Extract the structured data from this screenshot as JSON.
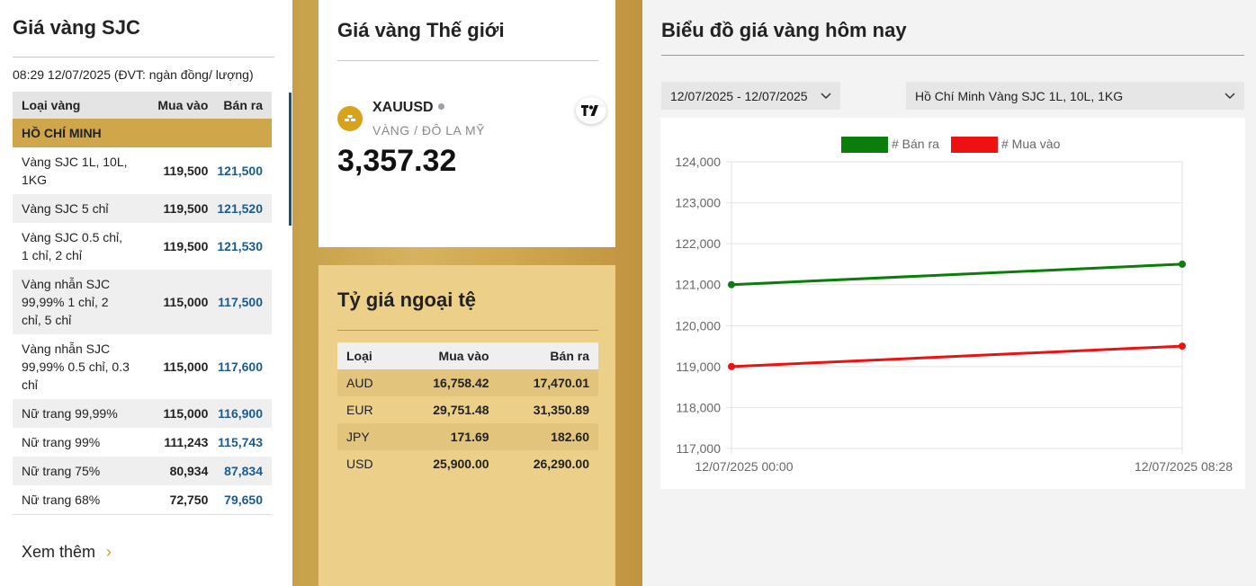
{
  "sjc": {
    "title": "Giá vàng SJC",
    "meta": "08:29 12/07/2025 (ĐVT: ngàn đồng/ lượng)",
    "headers": {
      "type": "Loại vàng",
      "buy": "Mua vào",
      "sell": "Bán ra"
    },
    "region": "HỒ CHÍ MINH",
    "rows": [
      {
        "name": "Vàng SJC 1L, 10L, 1KG",
        "buy": "119,500",
        "sell": "121,500"
      },
      {
        "name": "Vàng SJC 5 chỉ",
        "buy": "119,500",
        "sell": "121,520"
      },
      {
        "name": "Vàng SJC 0.5 chỉ, 1 chỉ, 2 chỉ",
        "buy": "119,500",
        "sell": "121,530"
      },
      {
        "name": "Vàng nhẫn SJC 99,99% 1 chỉ, 2 chỉ, 5 chỉ",
        "buy": "115,000",
        "sell": "117,500"
      },
      {
        "name": "Vàng nhẫn SJC 99,99% 0.5 chỉ, 0.3 chỉ",
        "buy": "115,000",
        "sell": "117,600"
      },
      {
        "name": "Nữ trang 99,99%",
        "buy": "115,000",
        "sell": "116,900"
      },
      {
        "name": "Nữ trang 99%",
        "buy": "111,243",
        "sell": "115,743"
      },
      {
        "name": "Nữ trang 75%",
        "buy": "80,934",
        "sell": "87,834"
      },
      {
        "name": "Nữ trang 68%",
        "buy": "72,750",
        "sell": "79,650"
      }
    ],
    "more_label": "Xem thêm"
  },
  "world": {
    "title": "Giá vàng Thế giới",
    "symbol": "XAUUSD",
    "subtitle": "VÀNG / ĐÔ LA MỸ",
    "price": "3,357.32"
  },
  "fx": {
    "title": "Tỷ giá ngoại tệ",
    "headers": {
      "type": "Loại",
      "buy": "Mua vào",
      "sell": "Bán ra"
    },
    "rows": [
      {
        "code": "AUD",
        "buy": "16,758.42",
        "sell": "17,470.01"
      },
      {
        "code": "EUR",
        "buy": "29,751.48",
        "sell": "31,350.89"
      },
      {
        "code": "JPY",
        "buy": "171.69",
        "sell": "182.60"
      },
      {
        "code": "USD",
        "buy": "25,900.00",
        "sell": "26,290.00"
      }
    ]
  },
  "chart_panel": {
    "title": "Biểu đồ giá vàng hôm nay",
    "date_range": "12/07/2025 - 12/07/2025",
    "location": "Hồ Chí Minh Vàng SJC 1L, 10L, 1KG"
  },
  "chart_data": {
    "type": "line",
    "x": [
      "12/07/2025 00:00",
      "12/07/2025 08:28"
    ],
    "series": [
      {
        "name": "# Bán ra",
        "values": [
          121000,
          121500
        ],
        "color": "#0a7d0a"
      },
      {
        "name": "# Mua vào",
        "values": [
          119000,
          119500
        ],
        "color": "#ee1111"
      }
    ],
    "ylim": [
      117000,
      124000
    ],
    "yticks": [
      124000,
      123000,
      122000,
      121000,
      120000,
      119000,
      118000,
      117000
    ],
    "ytick_labels": [
      "124,000",
      "123,000",
      "122,000",
      "121,000",
      "120,000",
      "119,000",
      "118,000",
      "117,000"
    ],
    "legend": "top",
    "grid": true
  },
  "colors": {
    "gold": "#cfa64a",
    "gold_light": "#ecd08a",
    "price_blue": "#1c5a8c"
  }
}
